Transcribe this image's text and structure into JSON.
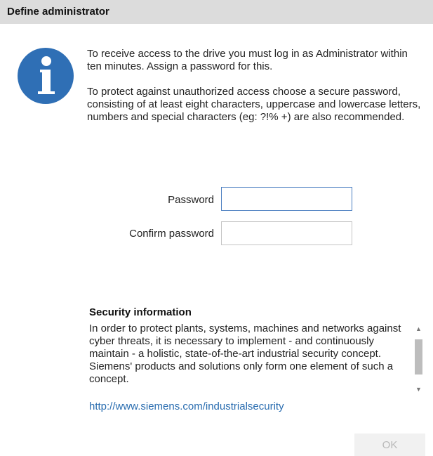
{
  "dialog": {
    "title": "Define administrator"
  },
  "message": {
    "icon": "info-icon",
    "paragraph1": "To receive access to the drive you must log in as Administrator within ten minutes. Assign a password for this.",
    "paragraph2": "To protect against unauthorized access choose a secure password, consisting of at least eight characters, uppercase and lowercase letters, numbers and special characters (eg: ?!% +) are also recommended."
  },
  "form": {
    "password_label": "Password",
    "password_value": "",
    "confirm_label": "Confirm password",
    "confirm_value": ""
  },
  "security": {
    "title": "Security information",
    "text": "In order to protect plants, systems, machines and networks against cyber threats, it is necessary to implement - and continuously maintain - a holistic, state-of-the-art industrial security concept. Siemens' products and solutions only form one element of such a concept.",
    "link": "http://www.siemens.com/industrialsecurity"
  },
  "buttons": {
    "ok_label": "OK",
    "ok_enabled": false
  },
  "colors": {
    "icon_blue": "#2f6fb5",
    "link_blue": "#2a6db0",
    "titlebar_bg": "#dcdcdc"
  }
}
